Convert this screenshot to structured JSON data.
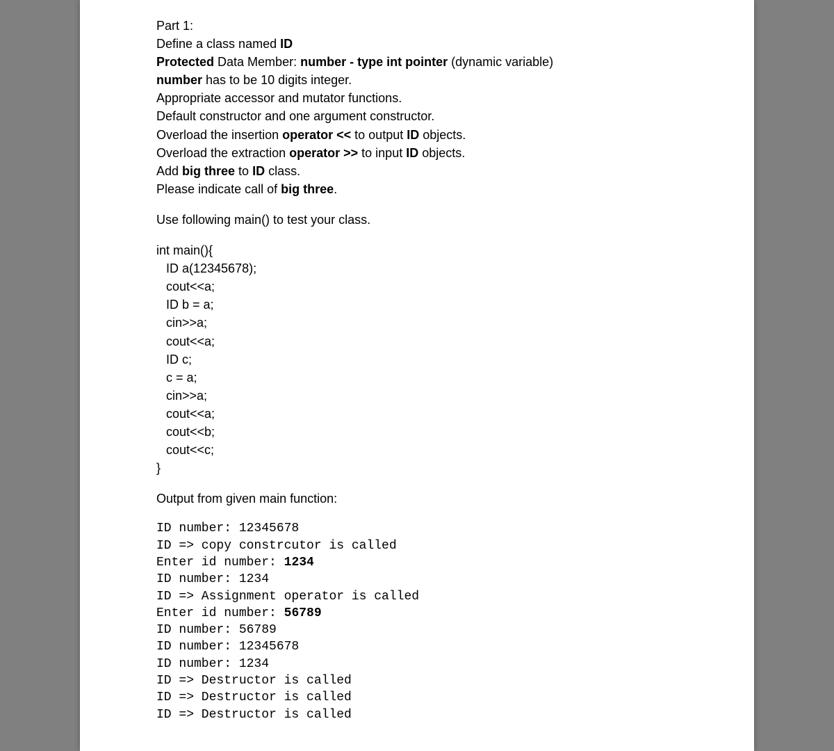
{
  "part_label": "Part 1:",
  "instructions": {
    "define_prefix": "Define a class named ",
    "define_class": "ID",
    "protected_label": "Protected",
    "protected_rest_1": " Data Member: ",
    "protected_member": "number - type int pointer",
    "protected_rest_2": " (dynamic variable)",
    "number_bold": "number",
    "number_rest": " has to be 10 digits integer.",
    "accessor": "Appropriate accessor and mutator functions.",
    "constructors": "Default constructor and one argument constructor.",
    "insertion_prefix": "Overload the insertion ",
    "operator_ins": "operator <<",
    "insertion_mid": " to output ",
    "insertion_id": "ID",
    "insertion_suffix": " objects.",
    "extraction_prefix": "Overload the extraction ",
    "operator_ext": "operator >>",
    "extraction_mid": " to input ",
    "extraction_id": "ID",
    "extraction_suffix": " objects.",
    "add_prefix": "Add ",
    "big_three_1": "big three",
    "add_mid": " to ",
    "add_id": "ID",
    "add_suffix": " class.",
    "indicate_prefix": "Please indicate call of ",
    "big_three_2": "big three",
    "indicate_suffix": "."
  },
  "use_main": "Use following main() to test your class.",
  "main_code": [
    "int main(){",
    "  ID a(12345678);",
    "  cout<<a;",
    "  ID b = a;",
    "  cin>>a;",
    "  cout<<a;",
    "  ID c;",
    "  c = a;",
    "  cin>>a;",
    "  cout<<a;",
    "  cout<<b;",
    "  cout<<c;",
    "}"
  ],
  "output_label": "Output from given main function:",
  "output_lines": [
    {
      "pre": "ID number: 12345678",
      "bold": ""
    },
    {
      "pre": "ID => copy constrcutor is called",
      "bold": ""
    },
    {
      "pre": "Enter id number: ",
      "bold": "1234"
    },
    {
      "pre": "ID number: 1234",
      "bold": ""
    },
    {
      "pre": "ID => Assignment operator is called",
      "bold": ""
    },
    {
      "pre": "Enter id number: ",
      "bold": "56789"
    },
    {
      "pre": "ID number: 56789",
      "bold": ""
    },
    {
      "pre": "ID number: 12345678",
      "bold": ""
    },
    {
      "pre": "ID number: 1234",
      "bold": ""
    },
    {
      "pre": "ID => Destructor is called",
      "bold": ""
    },
    {
      "pre": "ID => Destructor is called",
      "bold": ""
    },
    {
      "pre": "ID => Destructor is called",
      "bold": ""
    }
  ]
}
